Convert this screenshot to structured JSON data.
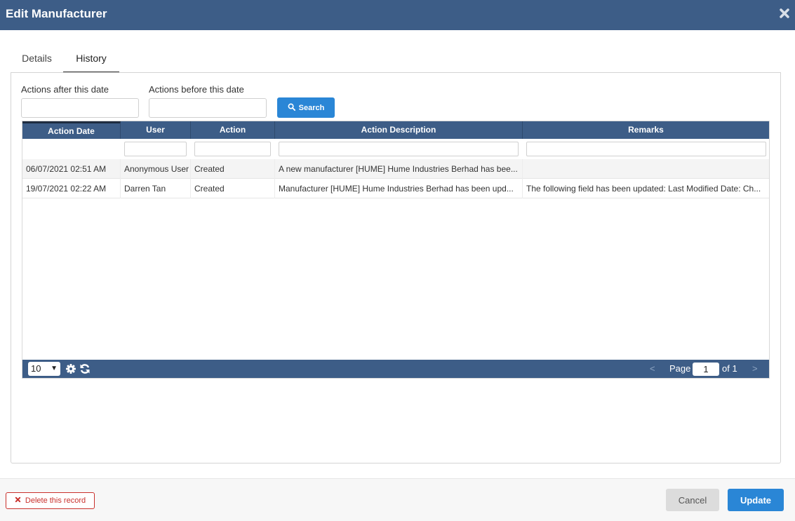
{
  "dialog": {
    "title": "Edit Manufacturer"
  },
  "tabs": [
    {
      "label": "Details"
    },
    {
      "label": "History"
    }
  ],
  "filters": {
    "after_label": "Actions after this date",
    "before_label": "Actions before this date",
    "search_label": "Search"
  },
  "grid": {
    "columns": [
      "Action Date",
      "User",
      "Action",
      "Action Description",
      "Remarks"
    ],
    "rows": [
      [
        "06/07/2021 02:51 AM",
        "Anonymous User",
        "Created",
        "A new manufacturer [HUME] Hume Industries Berhad has bee...",
        ""
      ],
      [
        "19/07/2021 02:22 AM",
        "Darren Tan",
        "Created",
        "Manufacturer [HUME] Hume Industries Berhad has been upd...",
        "The following field has been updated: Last Modified Date: Ch..."
      ]
    ],
    "page_size": "10",
    "pager": {
      "prev": "<",
      "page_label": "Page",
      "page_value": "1",
      "of_label": "of 1",
      "next": ">"
    }
  },
  "footer": {
    "delete_label": "Delete this record",
    "cancel_label": "Cancel",
    "update_label": "Update"
  },
  "colors": {
    "header": "#3d5d87",
    "primary": "#2a86d6",
    "danger": "#c9302c"
  }
}
